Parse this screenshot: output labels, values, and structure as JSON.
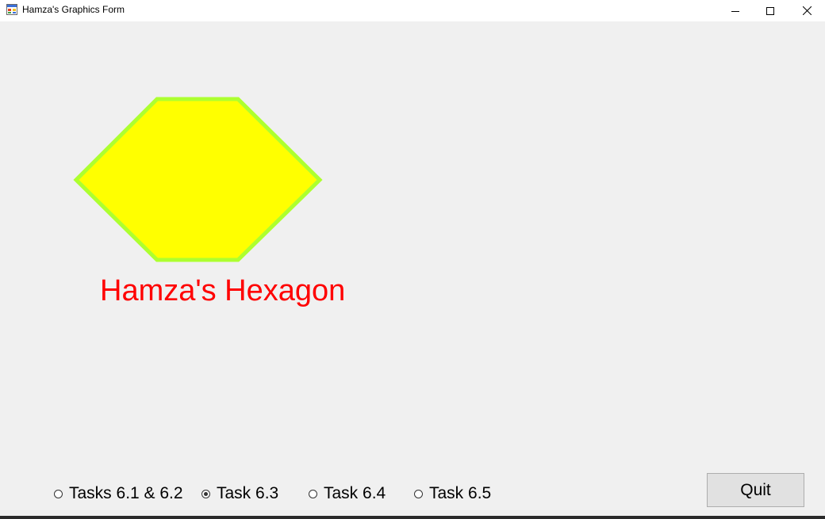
{
  "window": {
    "title": "Hamza's Graphics Form",
    "icon": "app-form-icon",
    "controls": {
      "minimize_icon": "minimize-icon",
      "maximize_icon": "maximize-icon",
      "close_icon": "close-icon"
    }
  },
  "drawing": {
    "shape": "hexagon",
    "fill_color": "#ffff00",
    "outline_color": "#adff2f",
    "label": "Hamza's Hexagon",
    "label_color": "#ff0000"
  },
  "radios": [
    {
      "label": "Tasks 6.1 & 6.2",
      "checked": false
    },
    {
      "label": "Task 6.3",
      "checked": true
    },
    {
      "label": "Task 6.4",
      "checked": false
    },
    {
      "label": "Task 6.5",
      "checked": false
    }
  ],
  "quit_button": {
    "label": "Quit"
  }
}
